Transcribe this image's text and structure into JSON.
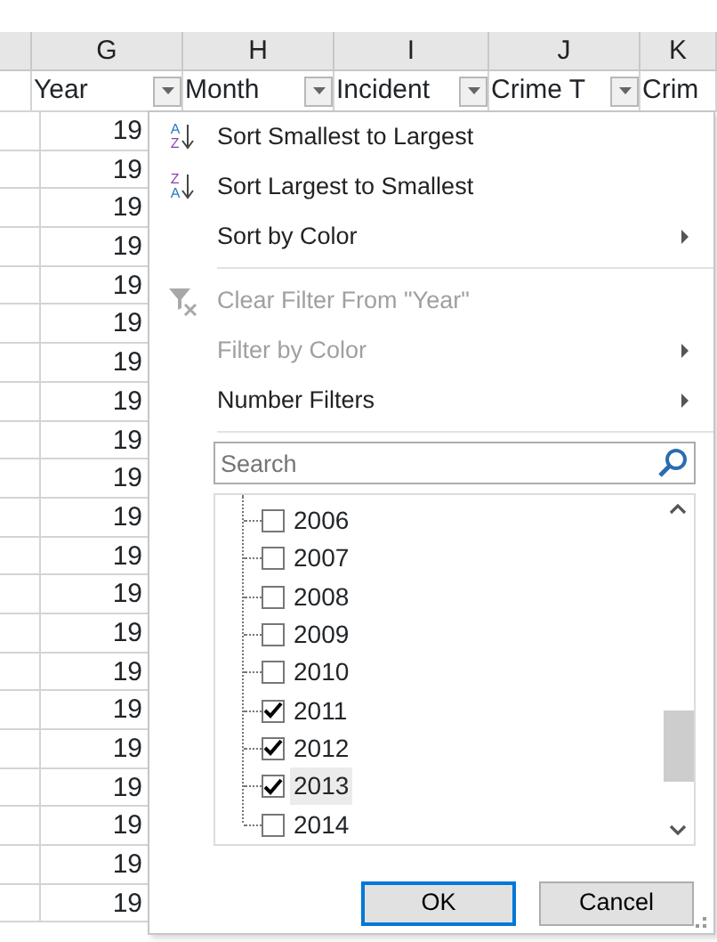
{
  "columns": [
    "G",
    "H",
    "I",
    "J",
    "K"
  ],
  "headers": [
    {
      "label": "Year"
    },
    {
      "label": "Month"
    },
    {
      "label": "Incident"
    },
    {
      "label": "Crime T"
    },
    {
      "label": "Crim"
    }
  ],
  "year_cells": [
    "19",
    "19",
    "19",
    "19",
    "19",
    "19",
    "19",
    "19",
    "19",
    "19",
    "19",
    "19",
    "19",
    "19",
    "19",
    "19",
    "19",
    "19",
    "19",
    "19",
    "19"
  ],
  "filter_menu": {
    "items": [
      {
        "kind": "sort_asc",
        "icon_letters": [
          "A",
          "Z"
        ],
        "label": "Sort Smallest to Largest",
        "disabled": false,
        "submenu": false
      },
      {
        "kind": "sort_desc",
        "icon_letters": [
          "Z",
          "A"
        ],
        "label": "Sort Largest to Smallest",
        "disabled": false,
        "submenu": false
      },
      {
        "kind": "plain",
        "label": "Sort by Color",
        "disabled": false,
        "submenu": true
      },
      {
        "kind": "separator"
      },
      {
        "kind": "clear",
        "label": "Clear Filter From \"Year\"",
        "disabled": true,
        "submenu": false
      },
      {
        "kind": "plain",
        "label": "Filter by Color",
        "disabled": true,
        "submenu": true
      },
      {
        "kind": "plain",
        "label": "Number Filters",
        "disabled": false,
        "submenu": true
      },
      {
        "kind": "separator"
      }
    ],
    "search": {
      "placeholder": "Search"
    },
    "values": [
      {
        "label": "2006",
        "checked": false,
        "selected": false
      },
      {
        "label": "2007",
        "checked": false,
        "selected": false
      },
      {
        "label": "2008",
        "checked": false,
        "selected": false
      },
      {
        "label": "2009",
        "checked": false,
        "selected": false
      },
      {
        "label": "2010",
        "checked": false,
        "selected": false
      },
      {
        "label": "2011",
        "checked": true,
        "selected": false
      },
      {
        "label": "2012",
        "checked": true,
        "selected": false
      },
      {
        "label": "2013",
        "checked": true,
        "selected": true
      },
      {
        "label": "2014",
        "checked": false,
        "selected": false
      }
    ],
    "buttons": [
      {
        "label": "OK",
        "default": true
      },
      {
        "label": "Cancel",
        "default": false
      }
    ]
  }
}
